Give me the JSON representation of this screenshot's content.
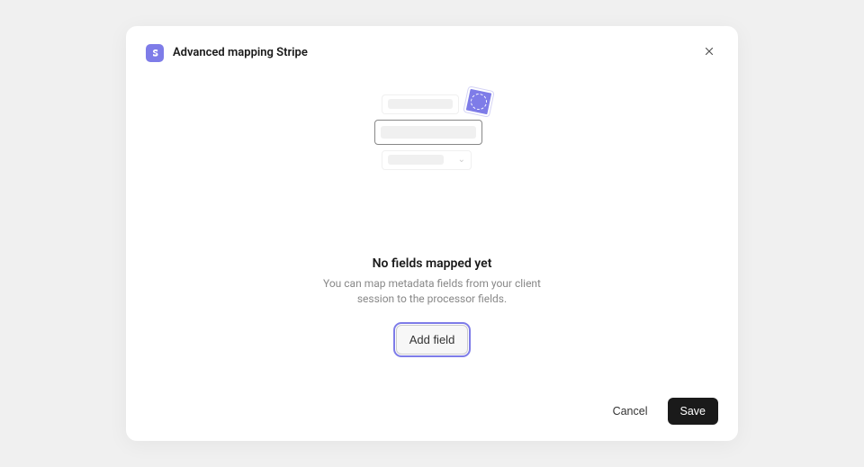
{
  "modal": {
    "title": "Advanced mapping Stripe",
    "icon": "stripe-icon"
  },
  "empty_state": {
    "title": "No fields mapped yet",
    "description": "You can map metadata fields from your client session to the processor fields.",
    "action_label": "Add field"
  },
  "footer": {
    "cancel_label": "Cancel",
    "save_label": "Save"
  },
  "colors": {
    "accent": "#7e7ce8",
    "text_primary": "#1a1a1a",
    "text_muted": "#888",
    "bg_page": "#f0f0f0"
  }
}
